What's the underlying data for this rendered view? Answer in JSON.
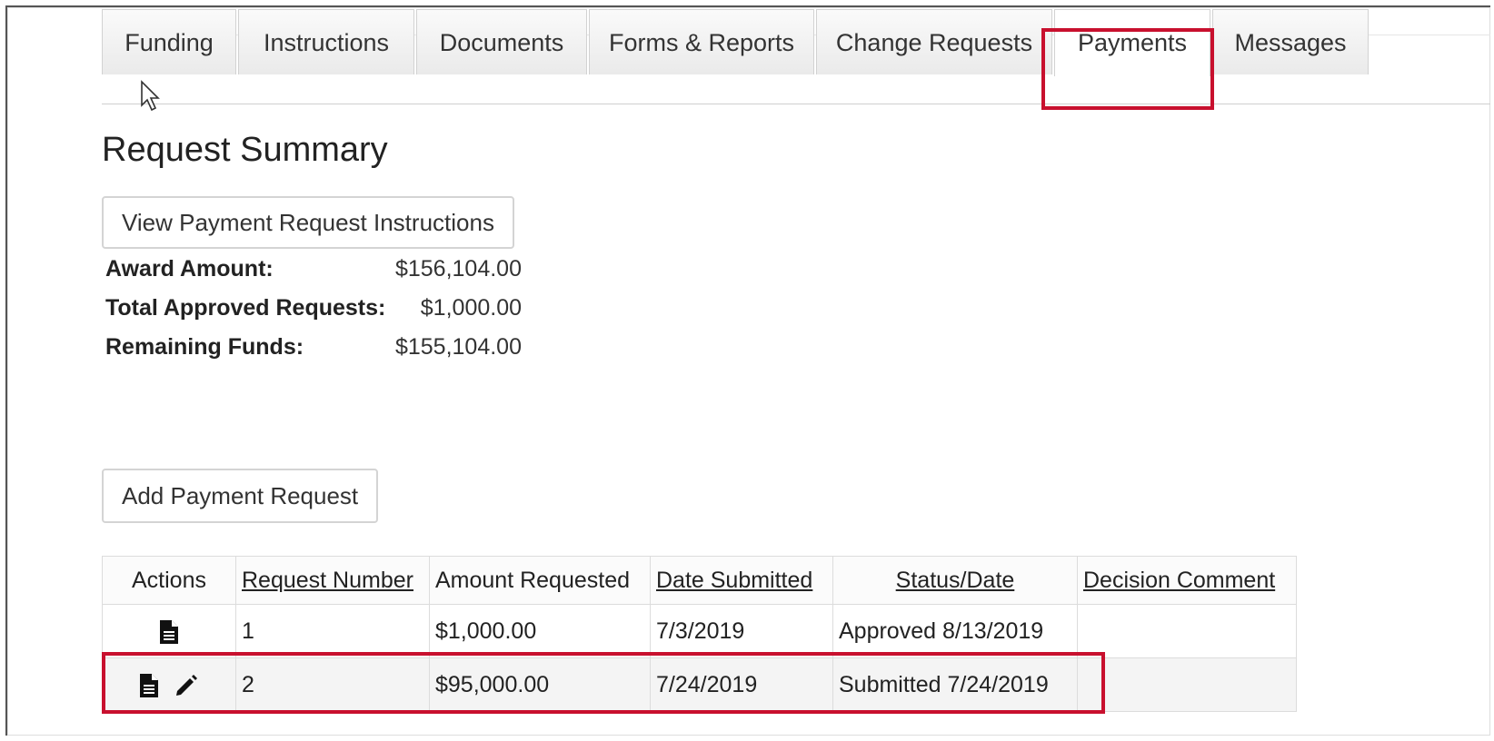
{
  "tabs": [
    {
      "label": "Funding"
    },
    {
      "label": "Instructions"
    },
    {
      "label": "Documents"
    },
    {
      "label": "Forms & Reports"
    },
    {
      "label": "Change Requests"
    },
    {
      "label": "Payments",
      "active": true
    },
    {
      "label": "Messages"
    }
  ],
  "page_title": "Request Summary",
  "view_instructions_label": "View Payment Request Instructions",
  "summary": {
    "award_label": "Award Amount:",
    "award_value": "$156,104.00",
    "approved_label": "Total Approved Requests:",
    "approved_value": "$1,000.00",
    "remaining_label": "Remaining Funds:",
    "remaining_value": "$155,104.00"
  },
  "add_request_label": "Add Payment Request",
  "table": {
    "headers": [
      "Actions",
      "Request Number",
      "Amount Requested",
      "Date Submitted",
      "Status/Date",
      "Decision Comment"
    ],
    "rows": [
      {
        "number": "1",
        "amount": "$1,000.00",
        "date": "7/3/2019",
        "status": "Approved 8/13/2019",
        "comment": "",
        "actions": [
          "document-icon"
        ]
      },
      {
        "number": "2",
        "amount": "$95,000.00",
        "date": "7/24/2019",
        "status": "Submitted 7/24/2019",
        "comment": "",
        "actions": [
          "document-icon",
          "pencil-icon"
        ]
      }
    ]
  },
  "colors": {
    "highlight": "#c8102e",
    "border": "#d4d4d4"
  }
}
